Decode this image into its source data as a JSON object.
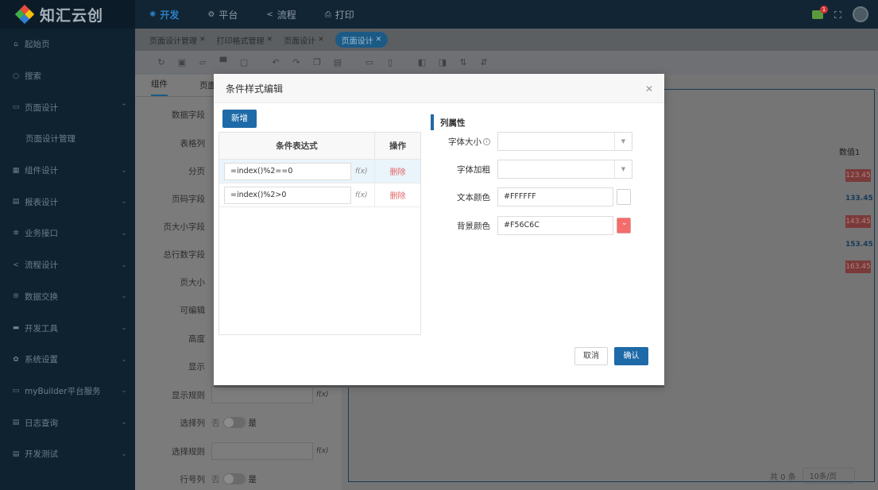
{
  "app": {
    "logo_text": "知汇云创"
  },
  "sidebar": {
    "items": [
      {
        "icon": "home-icon",
        "glyph": "⌂",
        "label": "起始页",
        "chevron": false
      },
      {
        "icon": "search-icon",
        "glyph": "○",
        "label": "搜索",
        "chevron": false
      },
      {
        "icon": "briefcase-icon",
        "glyph": "▭",
        "label": "页面设计",
        "chevron": true
      },
      {
        "icon": "",
        "glyph": "",
        "label": "页面设计管理",
        "chevron": false,
        "sub": true
      },
      {
        "icon": "grid-icon",
        "glyph": "▦",
        "label": "组件设计",
        "chevron": true
      },
      {
        "icon": "report-icon",
        "glyph": "▤",
        "label": "报表设计",
        "chevron": true
      },
      {
        "icon": "gear-icon",
        "glyph": "✲",
        "label": "业务接口",
        "chevron": true
      },
      {
        "icon": "share-icon",
        "glyph": "<",
        "label": "流程设计",
        "chevron": true
      },
      {
        "icon": "database-icon",
        "glyph": "⊜",
        "label": "数据交换",
        "chevron": true
      },
      {
        "icon": "toolbox-icon",
        "glyph": "▬",
        "label": "开发工具",
        "chevron": true
      },
      {
        "icon": "settings-icon",
        "glyph": "✿",
        "label": "系统设置",
        "chevron": true
      },
      {
        "icon": "chat-icon",
        "glyph": "▭",
        "label": "myBuilder平台服务",
        "chevron": true
      },
      {
        "icon": "log-icon",
        "glyph": "▤",
        "label": "日志查询",
        "chevron": true
      },
      {
        "icon": "test-icon",
        "glyph": "▤",
        "label": "开发测试",
        "chevron": true
      }
    ]
  },
  "topbar": {
    "tabs": [
      {
        "label": "开发",
        "glyph": "✺",
        "icon": "develop-icon",
        "active": true
      },
      {
        "label": "平台",
        "glyph": "⚙",
        "icon": "platform-icon",
        "active": false
      },
      {
        "label": "流程",
        "glyph": "<",
        "icon": "flow-icon",
        "active": false
      },
      {
        "label": "打印",
        "glyph": "⎙",
        "icon": "print-icon",
        "active": false
      }
    ],
    "notification_count": "1"
  },
  "page_tabs": [
    {
      "label": "页面设计管理",
      "active": false
    },
    {
      "label": "打印格式管理",
      "active": false
    },
    {
      "label": "页面设计",
      "active": false
    },
    {
      "label": "页面设计",
      "active": true
    }
  ],
  "toolbar": {
    "buttons": [
      {
        "name": "refresh-icon",
        "glyph": "↻"
      },
      {
        "name": "save-icon",
        "glyph": "▣"
      },
      {
        "name": "open-folder-icon",
        "glyph": "▱"
      },
      {
        "name": "print-icon",
        "glyph": "▀"
      },
      {
        "name": "preview-icon",
        "glyph": "▢"
      },
      {
        "name": "undo-icon",
        "glyph": "↶"
      },
      {
        "name": "redo-icon",
        "glyph": "↷"
      },
      {
        "name": "copy-icon",
        "glyph": "❐"
      },
      {
        "name": "paste-icon",
        "glyph": "▤"
      },
      {
        "name": "insert-icon",
        "glyph": "▭"
      },
      {
        "name": "delete-icon",
        "glyph": "▯"
      },
      {
        "name": "bring-front-icon",
        "glyph": "◧"
      },
      {
        "name": "send-back-icon",
        "glyph": "◨"
      },
      {
        "name": "sort-asc-icon",
        "glyph": "⇅"
      },
      {
        "name": "sort-desc-icon",
        "glyph": "⇵"
      }
    ]
  },
  "left_panel": {
    "tabs": [
      "组件",
      "页面"
    ],
    "rows": [
      {
        "label": "数据字段",
        "type": "none"
      },
      {
        "label": "表格列",
        "type": "none"
      },
      {
        "label": "分页",
        "type": "none"
      },
      {
        "label": "页码字段",
        "type": "none"
      },
      {
        "label": "页大小字段",
        "type": "none"
      },
      {
        "label": "总行数字段",
        "type": "none"
      },
      {
        "label": "页大小",
        "type": "none"
      },
      {
        "label": "可编辑",
        "type": "none"
      },
      {
        "label": "高度",
        "type": "none"
      },
      {
        "label": "显示",
        "type": "none"
      },
      {
        "label": "显示规则",
        "type": "input"
      },
      {
        "label": "选择列",
        "type": "switch"
      },
      {
        "label": "选择规则",
        "type": "input"
      },
      {
        "label": "行号列",
        "type": "switch"
      }
    ],
    "switch_off": "否",
    "switch_on": "是",
    "fx": "f(x)"
  },
  "preview": {
    "column_header": "数值1",
    "values": [
      {
        "text": "123.45",
        "style": "red"
      },
      {
        "text": "133.45",
        "style": "plain"
      },
      {
        "text": "143.45",
        "style": "red"
      },
      {
        "text": "153.45",
        "style": "plain"
      },
      {
        "text": "163.45",
        "style": "red"
      }
    ],
    "total_text": "共 0 条",
    "page_size": "10条/页"
  },
  "modal": {
    "title": "条件样式编辑",
    "add_label": "新增",
    "table_headers": {
      "expr": "条件表达式",
      "op": "操作"
    },
    "rows": [
      {
        "expr": "=index()%2==0",
        "fx": "f(x)",
        "delete": "删除"
      },
      {
        "expr": "=index()%2>0",
        "fx": "f(x)",
        "delete": "删除"
      }
    ],
    "attr_title": "列属性",
    "font_size_label": "字体大小",
    "font_weight_label": "字体加粗",
    "text_color_label": "文本颜色",
    "text_color_value": "#FFFFFF",
    "bg_color_label": "背景颜色",
    "bg_color_value": "#F56C6C",
    "cancel_label": "取消",
    "ok_label": "确认"
  },
  "colors": {
    "accent": "#1e6aa8",
    "danger": "#F56C6C",
    "sidebar": "#0e2230"
  }
}
